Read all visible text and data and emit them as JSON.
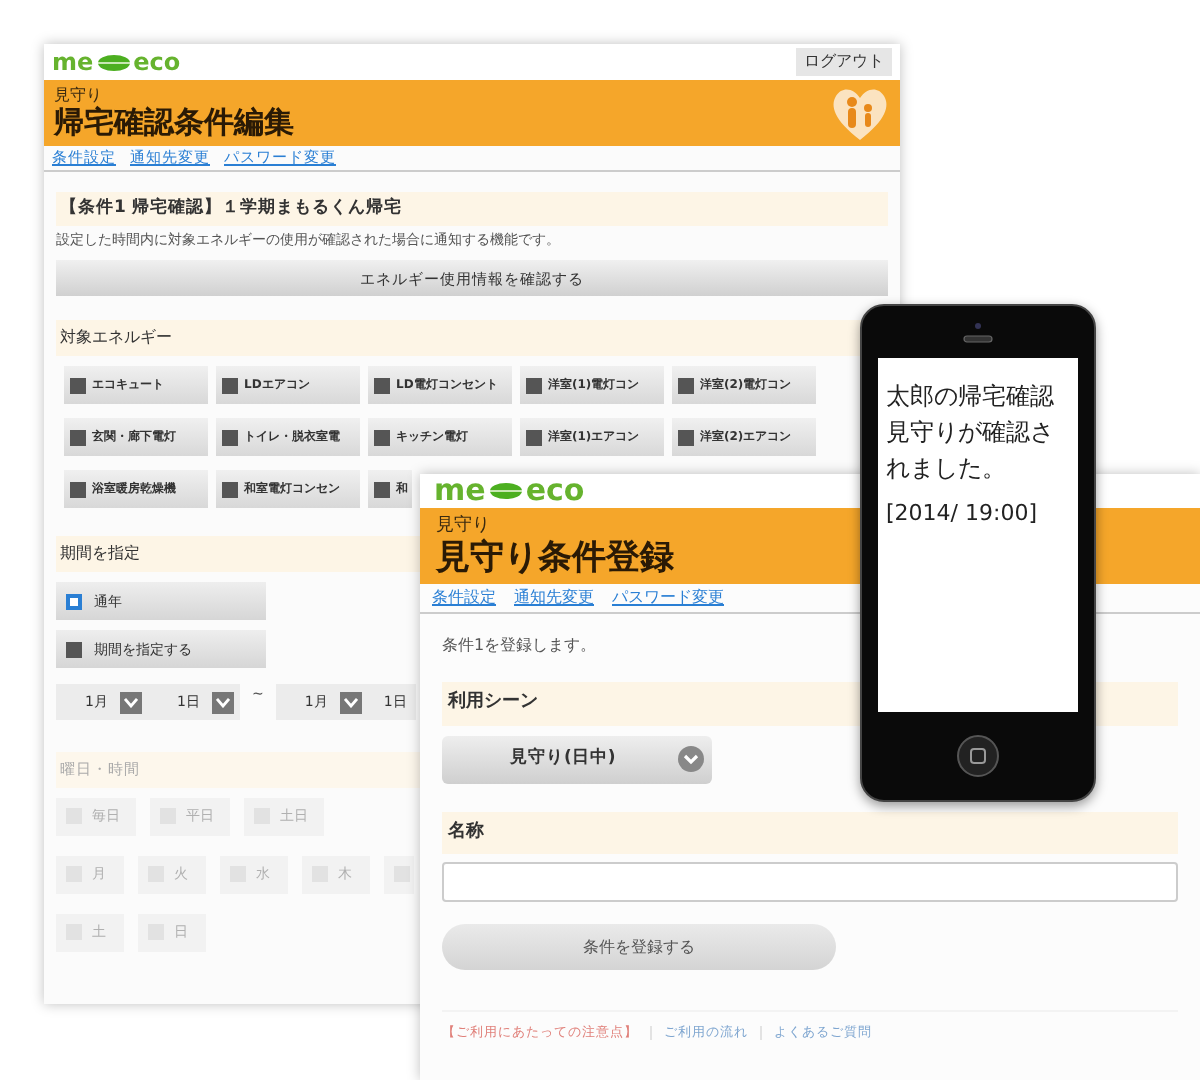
{
  "back_window": {
    "logo": {
      "left": "me",
      "right": "eco"
    },
    "logout_button": "ログアウト",
    "header": {
      "subtitle": "見守り",
      "title": "帰宅確認条件編集"
    },
    "nav_links": [
      "条件設定",
      "通知先変更",
      "パスワード変更"
    ],
    "condition_title": "【条件1 帰宅確認】１学期まもるくん帰宅",
    "description": "設定した時間内に対象エネルギーの使用が確認された場合に通知する機能です。",
    "energy_button": "エネルギー使用情報を確認する",
    "energy_section": {
      "heading": "対象エネルギー",
      "items": [
        {
          "label": "エコキュート",
          "checked": false
        },
        {
          "label": "LDエアコン",
          "checked": false
        },
        {
          "label": "LD電灯コンセント",
          "checked": false
        },
        {
          "label": "洋室(1)電灯コン",
          "checked": false
        },
        {
          "label": "洋室(2)電灯コン",
          "checked": false
        },
        {
          "label": "玄関・廊下電灯",
          "checked": false
        },
        {
          "label": "トイレ・脱衣室電",
          "checked": false
        },
        {
          "label": "キッチン電灯",
          "checked": false
        },
        {
          "label": "洋室(1)エアコン",
          "checked": false
        },
        {
          "label": "洋室(2)エアコン",
          "checked": false
        },
        {
          "label": "浴室暖房乾燥機",
          "checked": false
        },
        {
          "label": "和室電灯コンセン",
          "checked": false
        },
        {
          "label": "和",
          "checked": false
        }
      ]
    },
    "period_section": {
      "heading": "期間を指定",
      "options": [
        {
          "label": "通年",
          "selected": true
        },
        {
          "label": "期間を指定する",
          "selected": false
        }
      ],
      "range": {
        "from": [
          "1月",
          "1日"
        ],
        "separator": "~",
        "to": [
          "1月",
          "1日"
        ]
      }
    },
    "weekday_section": {
      "heading": "曜日・時間",
      "disabled": true,
      "rows": [
        [
          {
            "label": "毎日",
            "checked": false
          },
          {
            "label": "平日",
            "checked": false
          },
          {
            "label": "土日",
            "checked": false
          }
        ],
        [
          {
            "label": "月",
            "checked": false
          },
          {
            "label": "火",
            "checked": false
          },
          {
            "label": "水",
            "checked": false
          },
          {
            "label": "木",
            "checked": false
          },
          {
            "checked": false
          }
        ],
        [
          {
            "label": "土",
            "checked": false
          },
          {
            "label": "日",
            "checked": false
          }
        ]
      ]
    }
  },
  "front_window": {
    "logo": {
      "left": "me",
      "right": "eco"
    },
    "header": {
      "subtitle": "見守り",
      "title": "見守り条件登録"
    },
    "nav_links": [
      "条件設定",
      "通知先変更",
      "パスワード変更"
    ],
    "intro": "条件1を登録します。",
    "scene_heading": "利用シーン",
    "scene_select": "見守り(日中)",
    "name_heading": "名称",
    "submit_button": "条件を登録する",
    "footer_links": [
      "【ご利用にあたっての注意点】",
      "ご利用の流れ",
      "よくあるご質問"
    ]
  },
  "phone": {
    "message": "太郎の帰宅確認見守りが確認されました。",
    "timestamp": "[2014/ 19:00]"
  }
}
